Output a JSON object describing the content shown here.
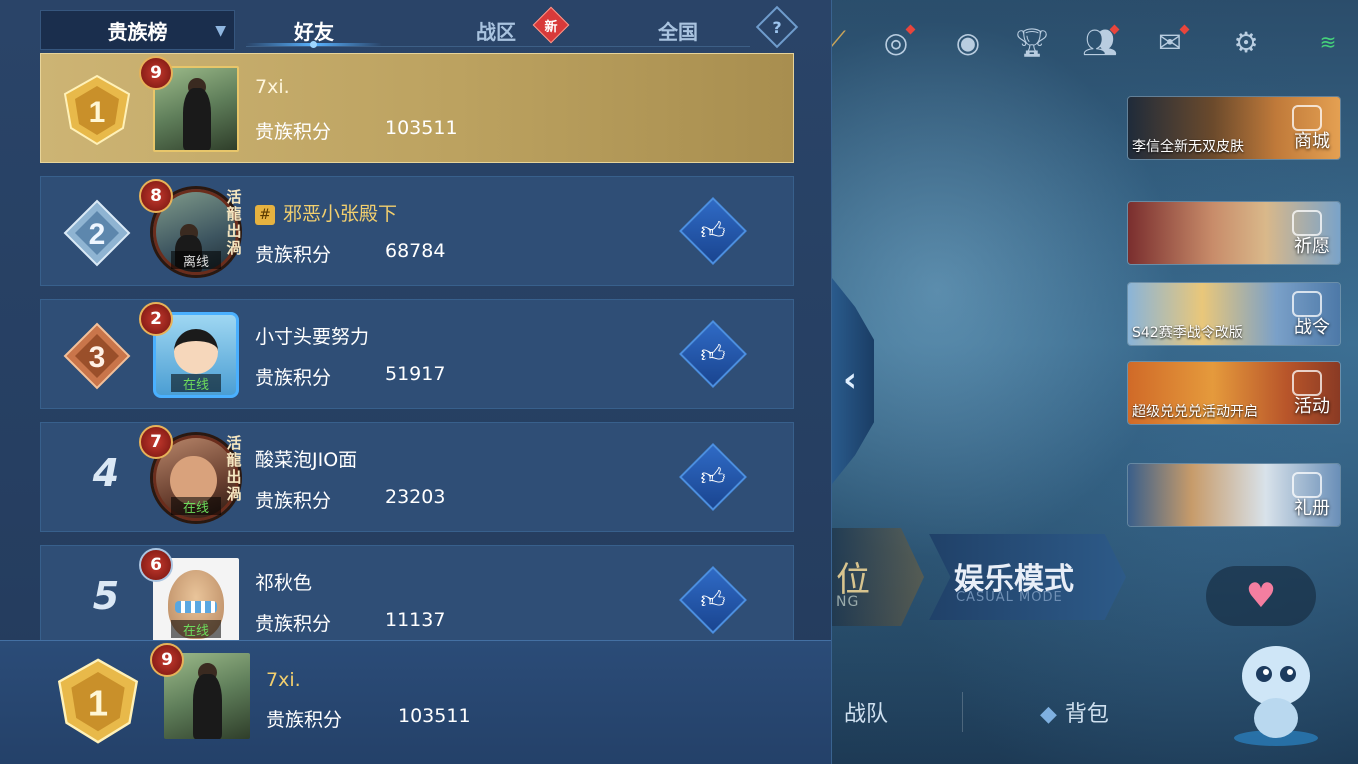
{
  "tabs": {
    "selector_label": "贵族榜",
    "friends": "好友",
    "region": "战区",
    "region_badge": "新",
    "national": "全国",
    "help": "?"
  },
  "rows": [
    {
      "rank": "1",
      "level": "9",
      "name": "7xi.",
      "score_label": "贵族积分",
      "score": "103511",
      "status": ""
    },
    {
      "rank": "2",
      "level": "8",
      "name": "邪恶小张殿下",
      "name_icon": "#",
      "score_label": "贵族积分",
      "score": "68784",
      "status": "离线",
      "frame_text": "活龍出渦"
    },
    {
      "rank": "3",
      "level": "2",
      "name": "小寸头要努力",
      "score_label": "贵族积分",
      "score": "51917",
      "status": "在线"
    },
    {
      "rank": "4",
      "level": "7",
      "name": "酸菜泡JIO面",
      "score_label": "贵族积分",
      "score": "23203",
      "status": "在线",
      "frame_text": "活龍出渦"
    },
    {
      "rank": "5",
      "level": "6",
      "name": "祁秋色",
      "score_label": "贵族积分",
      "score": "11137",
      "status": "在线"
    }
  ],
  "my_rank": {
    "rank": "1",
    "level": "9",
    "name": "7xi.",
    "score_label": "贵族积分",
    "score": "103511"
  },
  "right_panel": {
    "cards": [
      {
        "caption": "李信全新无双皮肤",
        "label": "商城"
      },
      {
        "caption": "",
        "label": "祈愿"
      },
      {
        "caption": "S42赛季战令改版",
        "label": "战令"
      },
      {
        "caption": "超级兑兑兑活动开启",
        "label": "活动"
      },
      {
        "caption": "",
        "label": "礼册"
      }
    ],
    "mode_left_text": "位",
    "mode_left_sub": "NG",
    "mode_casual": "娱乐模式",
    "mode_casual_sub": "CASUAL MODE",
    "bottom_team": "战队",
    "bottom_bag": "背包"
  },
  "colors": {
    "accent_blue": "#58b2ff",
    "gold_row": "#bca260",
    "online_green": "#6ddc5c"
  }
}
